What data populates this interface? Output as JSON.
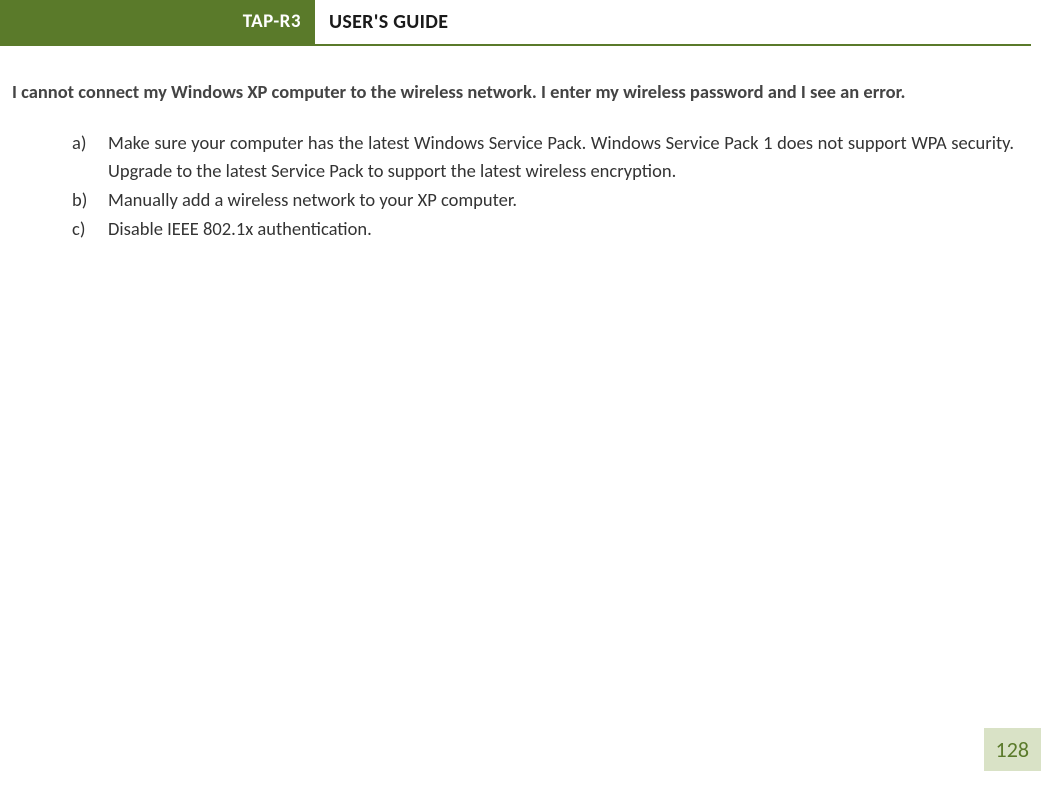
{
  "header": {
    "badge": "TAP-R3",
    "title": "USER'S GUIDE"
  },
  "question": "I cannot connect my Windows XP computer to the wireless network.  I enter my wireless password and I see an error.",
  "list": {
    "items": [
      {
        "marker": "a)",
        "text": "Make sure your computer has the latest Windows Service Pack.  Windows Service Pack 1 does not support WPA security.  Upgrade to the latest Service Pack to support the latest wireless encryption.",
        "justified": true
      },
      {
        "marker": "b)",
        "text": "Manually add a wireless network to your XP computer.",
        "justified": false
      },
      {
        "marker": "c)",
        "text": "Disable IEEE 802.1x authentication.",
        "justified": false
      }
    ]
  },
  "page_number": "128"
}
